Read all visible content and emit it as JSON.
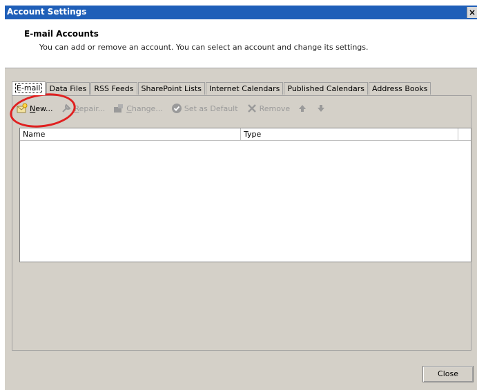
{
  "window": {
    "title": "Account Settings",
    "close_glyph": "×"
  },
  "header": {
    "heading": "E-mail Accounts",
    "description": "You can add or remove an account. You can select an account and change its settings."
  },
  "tabs": [
    {
      "label": "E-mail",
      "active": true
    },
    {
      "label": "Data Files"
    },
    {
      "label": "RSS Feeds"
    },
    {
      "label": "SharePoint Lists"
    },
    {
      "label": "Internet Calendars"
    },
    {
      "label": "Published Calendars"
    },
    {
      "label": "Address Books"
    }
  ],
  "toolbar": {
    "new_label": "New...",
    "repair_label": "Repair...",
    "change_label": "Change...",
    "set_default_label": "Set as Default",
    "remove_label": "Remove"
  },
  "list": {
    "col_name": "Name",
    "col_type": "Type"
  },
  "footer": {
    "close_label": "Close"
  },
  "colors": {
    "titlebar": "#1f5fb8",
    "annotation_circle": "#e02020",
    "dialog_bg": "#d4d0c8"
  }
}
